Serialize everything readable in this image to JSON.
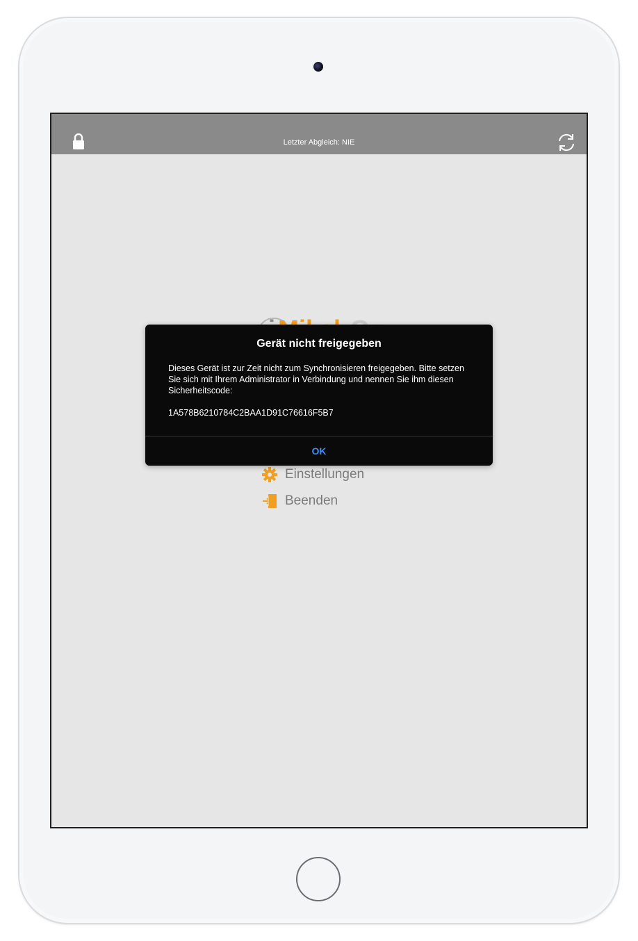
{
  "app": {
    "top_bar": {
      "sync_status": "Letzter Abgleich: NIE",
      "lock_icon": "lock-icon",
      "sync_icon": "sync-icon"
    },
    "logo": {
      "text_prefix": "i",
      "text_main": "Mikel",
      "text_suffix": "Go"
    },
    "menu": {
      "items": [
        {
          "label": "Einstellungen",
          "icon": "gear-icon"
        },
        {
          "label": "Beenden",
          "icon": "exit-icon"
        }
      ]
    },
    "colors": {
      "top_bar": "#8a8a8a",
      "background": "#e6e6e6",
      "accent": "#f0a020",
      "dialog_bg": "#0a0a0a",
      "dialog_button": "#3a8ef6"
    }
  },
  "dialog": {
    "title": "Gerät nicht freigegeben",
    "message": "Dieses Gerät ist zur Zeit nicht zum Synchronisieren freigegeben. Bitte setzen Sie sich mit Ihrem Administrator in Verbindung und nennen Sie ihm diesen Sicherheitscode:\n\n1A578B6210784C2BAA1D91C76616F5B7",
    "ok_label": "OK"
  }
}
